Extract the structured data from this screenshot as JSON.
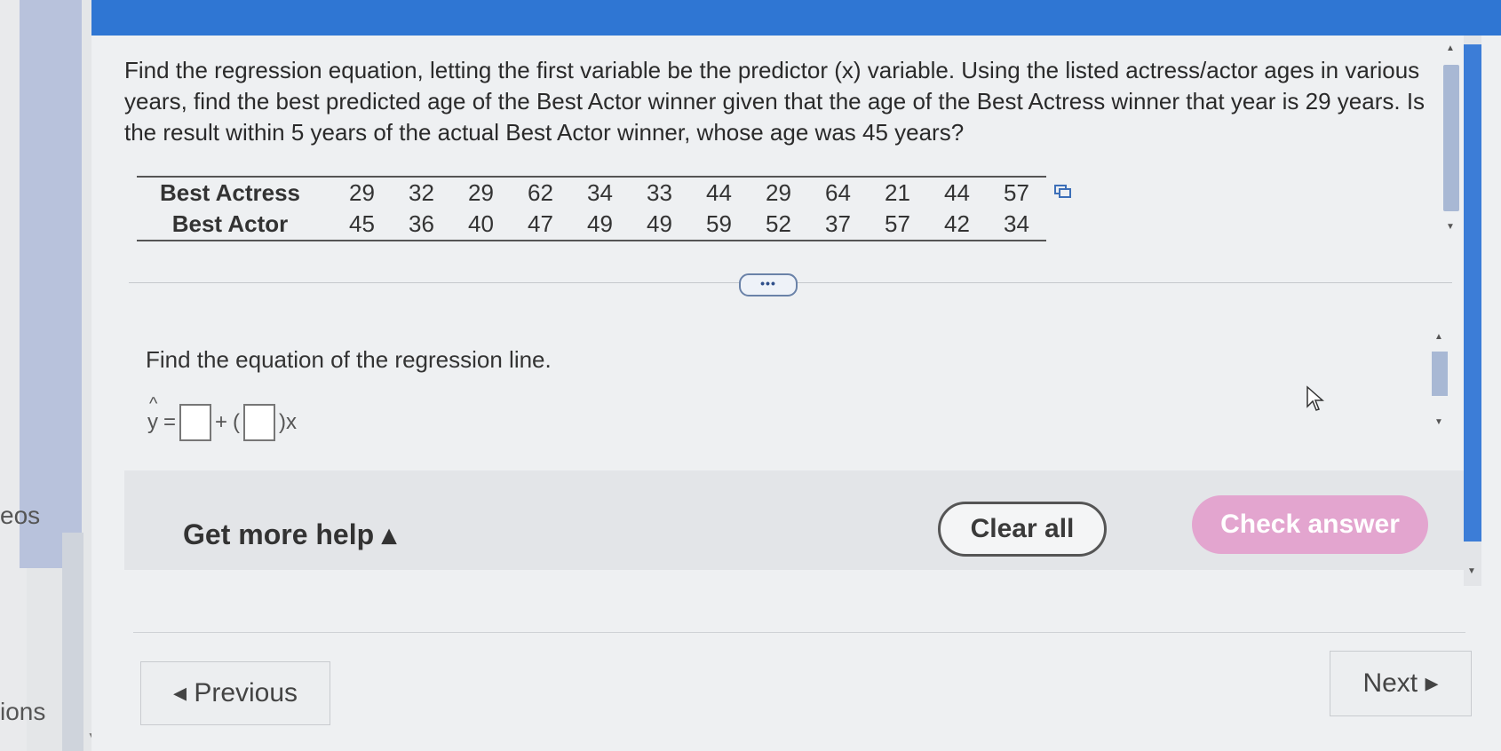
{
  "sidebar": {
    "label_1": "eos",
    "label_2": "ions"
  },
  "question": {
    "text": "Find the regression equation, letting the first variable be the predictor (x) variable. Using the listed actress/actor ages in various years, find the best predicted age of the Best Actor winner given that the age of the Best Actress winner that year is 29 years. Is the result within 5 years of the actual Best Actor winner, whose age was 45 years?"
  },
  "table": {
    "rows": [
      {
        "label": "Best Actress",
        "values": [
          "29",
          "32",
          "29",
          "62",
          "34",
          "33",
          "44",
          "29",
          "64",
          "21",
          "44",
          "57"
        ]
      },
      {
        "label": "Best Actor",
        "values": [
          "45",
          "36",
          "40",
          "47",
          "49",
          "49",
          "59",
          "52",
          "37",
          "57",
          "42",
          "34"
        ]
      }
    ]
  },
  "more_toggle": "•••",
  "prompt": "Find the equation of the regression line.",
  "equation": {
    "lhs": "y",
    "hat": "^",
    "eq": "=",
    "plus": "+",
    "open": "(",
    "suffix": ")x"
  },
  "help": {
    "label": "Get more help ▴"
  },
  "buttons": {
    "clear": "Clear all",
    "check": "Check answer",
    "previous": "◂ Previous",
    "next": "Next ▸"
  },
  "colors": {
    "banner": "#2f76d3",
    "check_button": "#e3a5cf",
    "scroll_thumb": "#3c7dd7"
  }
}
